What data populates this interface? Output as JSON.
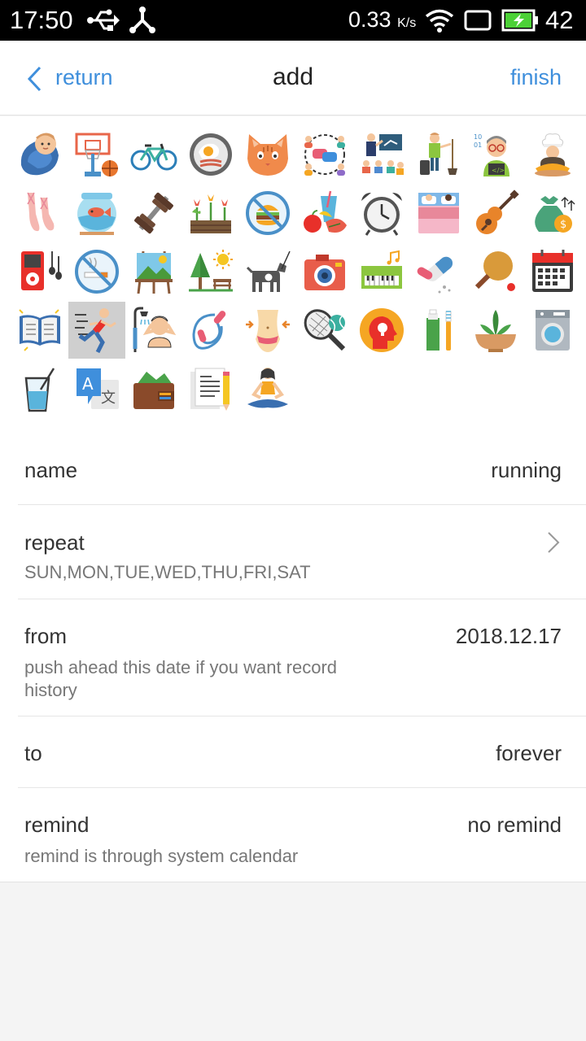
{
  "status_bar": {
    "time": "17:50",
    "network_speed": "0.33",
    "network_unit": "K/s",
    "battery_level": "42",
    "icons": [
      "usb-icon",
      "share-icon",
      "wifi-icon",
      "screen-icon",
      "battery-charging-icon"
    ]
  },
  "header": {
    "back_label": "return",
    "title": "add",
    "finish_label": "finish"
  },
  "icon_grid": {
    "selected_icon": "running",
    "icons": [
      "baby",
      "basketball",
      "bicycle",
      "breakfast",
      "cat",
      "chat",
      "teaching",
      "cleaning",
      "programmer",
      "chef",
      "ballet",
      "fishbowl",
      "dumbbell",
      "flowers",
      "no-junk-food",
      "fruit-juice",
      "alarm-clock",
      "bed",
      "guitar",
      "money-bag",
      "music-player",
      "no-smoking",
      "painting",
      "park",
      "dog-walking",
      "camera",
      "piano",
      "medicine",
      "ping-pong",
      "calendar",
      "reading",
      "running",
      "shower",
      "jump-rope",
      "waist",
      "tennis",
      "idea",
      "toothbrush",
      "plant",
      "washing-machine",
      "drink",
      "translate",
      "wallet",
      "writing",
      "meditation"
    ]
  },
  "settings": {
    "name": {
      "label": "name",
      "value": "running"
    },
    "repeat": {
      "label": "repeat",
      "value": "SUN,MON,TUE,WED,THU,FRI,SAT"
    },
    "from": {
      "label": "from",
      "value": "2018.12.17",
      "hint": "push ahead this date if you want record history"
    },
    "to": {
      "label": "to",
      "value": "forever"
    },
    "remind": {
      "label": "remind",
      "value": "no remind",
      "hint": "remind is through system calendar"
    }
  },
  "colors": {
    "accent": "#3f8fdc",
    "selected_bg": "#cfcfcf",
    "page_bg": "#f4f4f4"
  }
}
